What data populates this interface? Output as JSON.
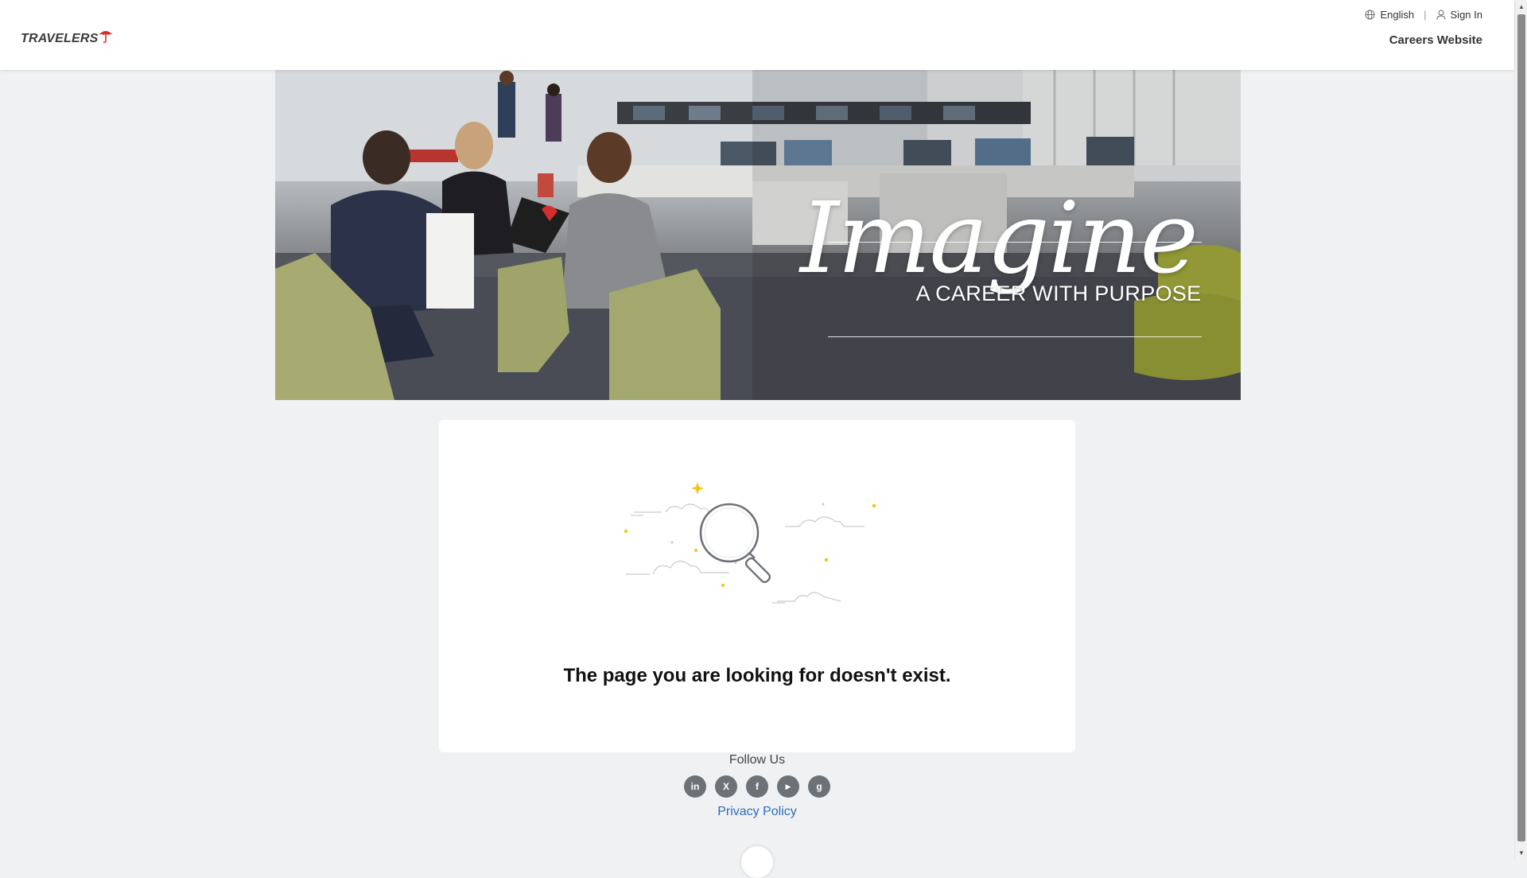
{
  "header": {
    "logo_text": "TRAVELERS",
    "language_label": "English",
    "separator": "|",
    "sign_in_label": "Sign In",
    "careers_link": "Careers Website"
  },
  "hero": {
    "script_title": "Imagine",
    "tagline": "A CAREER WITH PURPOSE"
  },
  "error": {
    "message": "The page you are looking for doesn't exist."
  },
  "footer": {
    "follow_title": "Follow Us",
    "social": [
      {
        "icon": "linkedin-icon",
        "glyph": "in"
      },
      {
        "icon": "x-icon",
        "glyph": "X"
      },
      {
        "icon": "facebook-icon",
        "glyph": "f"
      },
      {
        "icon": "youtube-icon",
        "glyph": "▶"
      },
      {
        "icon": "glassdoor-icon",
        "glyph": "g"
      }
    ],
    "privacy_link": "Privacy Policy"
  },
  "colors": {
    "brand_red": "#d32f2f",
    "link_blue": "#2a6ebd",
    "page_bg": "#f0f1f2",
    "social_bg": "#6d7278"
  }
}
